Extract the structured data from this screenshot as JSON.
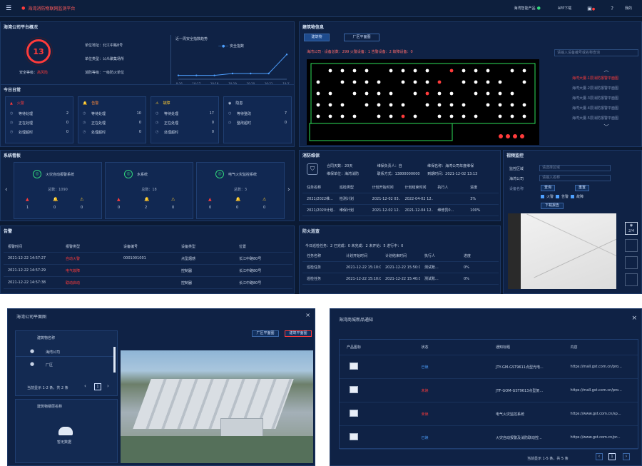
{
  "topbar": {
    "title": "海湾消防物联网监测平台",
    "right_items": [
      "海湾智能产品",
      "APP下载",
      "告警",
      "帮助",
      "我的"
    ]
  },
  "overview": {
    "title": "海湾公司平台概况",
    "score": "13",
    "safety_label": "安全等级：",
    "safety_value": "高风险",
    "info": [
      "单位地址：北江中路8号",
      "单位类型：公众聚集场所",
      "消防等级：一级防火单位"
    ],
    "trend_title": "近一周安全指数趋势",
    "trend_legend": "安全指数",
    "trend_x": [
      "10-16",
      "10-17",
      "10-18",
      "10-19",
      "10-20",
      "10-21",
      "10-22"
    ]
  },
  "chart_data": {
    "type": "line",
    "categories": [
      "10-16",
      "10-17",
      "10-18",
      "10-19",
      "10-20",
      "10-21",
      "10-22"
    ],
    "series": [
      {
        "name": "安全指数",
        "values": [
          2,
          2,
          2,
          3,
          3,
          3,
          13
        ]
      }
    ],
    "title": "近一周安全指数趋势",
    "ylim": [
      0,
      15
    ]
  },
  "today": {
    "title": "今日日常",
    "cards": [
      {
        "name": "火警",
        "color": "#ff3b3b",
        "rows": [
          [
            "等待处理",
            "2"
          ],
          [
            "正在处理",
            "0"
          ],
          [
            "处理超时",
            "0"
          ]
        ]
      },
      {
        "name": "告警",
        "color": "#ff8a3b",
        "rows": [
          [
            "等待处理",
            "10"
          ],
          [
            "正在处理",
            "0"
          ],
          [
            "处理超时",
            "0"
          ]
        ]
      },
      {
        "name": "故障",
        "color": "#ffcc33",
        "rows": [
          [
            "等待处理",
            "17"
          ],
          [
            "正在处理",
            "0"
          ],
          [
            "处理超时",
            "0"
          ]
        ]
      },
      {
        "name": "隐患",
        "color": "#c7d3e6",
        "rows": [
          [
            "等待整改",
            "7"
          ],
          [
            "整改超时",
            "0"
          ]
        ]
      }
    ]
  },
  "building": {
    "title": "建筑物信息",
    "tabs": [
      "建筑物",
      "厂区平面图"
    ],
    "stats": "海湾公司 · 设备总数：299   火警设备：1   告警设备：2   故障设备：0",
    "search_placeholder": "请输入设备编号或名称查询",
    "floors": [
      "海湾大厦-1层消防报警平面图",
      "海湾大厦-2层消防报警平面图",
      "海湾大厦-3层消防报警平面图",
      "海湾大厦-4层消防报警平面图",
      "海湾大厦-5层消防报警平面图"
    ]
  },
  "systems": {
    "title": "系统看板",
    "items": [
      {
        "name": "火灾自动报警系统",
        "total": "总数：1090",
        "counts": [
          "1",
          "0",
          "0"
        ]
      },
      {
        "name": "水系统",
        "total": "总数：18",
        "counts": [
          "0",
          "2",
          "0"
        ]
      },
      {
        "name": "电气火灾监控系统",
        "total": "总数：3",
        "counts": [
          "0",
          "0",
          "0"
        ]
      }
    ]
  },
  "maintenance": {
    "title": "消防维保",
    "info": [
      "合同天数：20天",
      "维保负责人：自",
      "维保名称：海湾公司年度维保",
      "维保单位：海湾消防",
      "联系方式：13800000000",
      "到期时间：2021-12-02 13:13"
    ],
    "headers": [
      "任务名称",
      "巡检类型",
      "计划开始时间",
      "计划结束时间",
      "执行人",
      "进度"
    ],
    "rows": [
      [
        "2021/2022维...",
        "检测计划",
        "2021-12-02 03...",
        "2022-04-02 12...",
        "",
        "3%"
      ],
      [
        "2021/2020计划...",
        "维保计划",
        "2021-12-02 12...",
        "2021-12-04 12...",
        "维修员0...",
        "100%"
      ]
    ]
  },
  "monitor": {
    "title": "视频监控",
    "labels": [
      "监控区域",
      "海湾公司",
      "设备名称"
    ],
    "inputs": [
      "请选择区域",
      "请输入名称"
    ],
    "buttons": [
      "查询",
      "重置"
    ],
    "checks": [
      "火警",
      "告警",
      "故障"
    ],
    "download": "下载报告",
    "side_label": "2/4"
  },
  "alarms": {
    "title": "告警",
    "headers": [
      "报警时间",
      "报警类型",
      "设备编号",
      "设备类型",
      "位置"
    ],
    "rows": [
      [
        "2021-12-22 14:57:27",
        "自动火警",
        "0001001001",
        "点型烟感",
        "长江中路80号"
      ],
      [
        "2021-12-22 14:57:29",
        "电气故障",
        "",
        "控制器",
        "长江中路80号"
      ],
      [
        "2021-12-22 14:57:38",
        "联动启动",
        "",
        "控制器",
        "长江中路80号"
      ]
    ]
  },
  "inspection": {
    "title": "防火巡查",
    "summary": "今日巡检任务：2   已完成：0   未完成：2   未开始：5   进行中：0",
    "headers": [
      "任务名称",
      "计划开始时间",
      "计划结束时间",
      "执行人",
      "进度"
    ],
    "rows": [
      [
        "巡检任务",
        "2021-12-22 15:10:00",
        "2021-12-22 15:50:00",
        "测试账...",
        "0%"
      ],
      [
        "巡检任务",
        "2021-12-22 15:10:00",
        "2021-12-22 15:40:00",
        "测试账...",
        "0%"
      ]
    ]
  },
  "plan_modal": {
    "title": "海湾公司平面图",
    "list_header": "建筑物名称",
    "items": [
      "海湾公司",
      "厂区"
    ],
    "pagination": "当前显示 1-2 条，共 2 条",
    "page": "1",
    "sub_header": "建筑物楼层名称",
    "no_data": "暂无数据",
    "buttons": [
      "厂区平面图",
      "建筑平面图"
    ]
  },
  "product_modal": {
    "title": "海湾商城新品通知",
    "headers": [
      "产品图标",
      "状态",
      "通知标题",
      "内容"
    ],
    "rows": [
      {
        "status": "已读",
        "status_color": "#4ea0ff",
        "title": "JTY-GM-GST9611点型光电...",
        "content": "https://mall.gst.com.cn/pro..."
      },
      {
        "status": "未读",
        "status_color": "#ff3b3b",
        "title": "JTF-GOM-GST9613点型复...",
        "content": "https://mall.gst.com.cn/pro..."
      },
      {
        "status": "未读",
        "status_color": "#ff3b3b",
        "title": "电气火灾监控系统",
        "content": "https://www.gst.com.cn/sp..."
      },
      {
        "status": "已读",
        "status_color": "#4ea0ff",
        "title": "火灾自动报警及消防联动控...",
        "content": "https://www.gst.com.cn/pr..."
      }
    ],
    "pagination": "当前显示 1-5 条，共 5 条",
    "page": "1"
  }
}
